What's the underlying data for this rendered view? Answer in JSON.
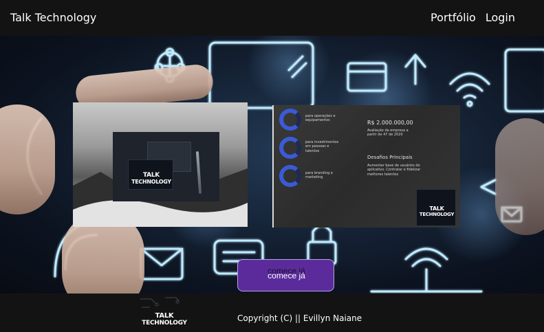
{
  "header": {
    "brand": "Talk Technology",
    "nav": [
      "Portfólio",
      "Login"
    ]
  },
  "hero": {
    "card_left": {
      "logo_line1": "TALK",
      "logo_line2": "TECHNOLOGY"
    },
    "card_right": {
      "stats": [
        "para operações e equipamentos",
        "para investimentos em pessoas e talentos",
        "para branding e marketing"
      ],
      "amount": "R$ 2.000.000,00",
      "amount_note": "Avaliação da empresa a partir de 47 de 2020",
      "challenges_title": "Desafios Principais",
      "challenges_text": "Aumentar base de usuários do aplicativo. Contratar e fidelizar melhores talentos",
      "logo_line1": "TALK",
      "logo_line2": "TECHNOLOGY"
    },
    "cta_shadow_label": "comece já",
    "cta_label": "comece já"
  },
  "footer": {
    "logo_line1": "TALK",
    "logo_line2": "TECHNOLOGY",
    "copyright": "Copyright (C) || Evillyn Naiane"
  },
  "colors": {
    "background": "#141313",
    "accent": "#5b2b9c",
    "ring": "#3a5bd8"
  }
}
